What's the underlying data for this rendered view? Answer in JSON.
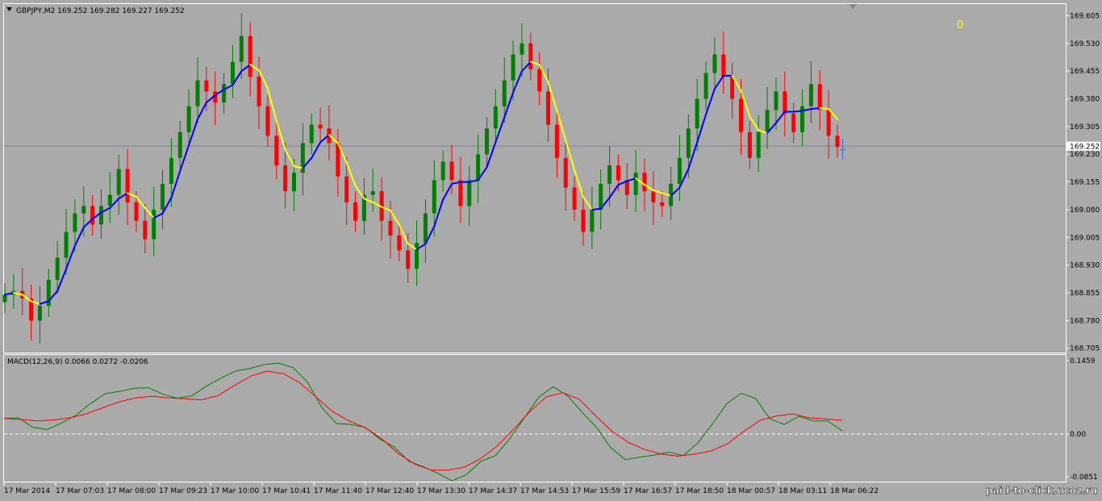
{
  "symbol_header": {
    "arrow": "▼",
    "text": "GBPJPY,M2  169.252 169.282 169.227 169.252"
  },
  "corner_counter": "0",
  "macd_header": "MACD(12,26,9) 0.0066 0.0272 -0.0206",
  "watermark": "paid-to-click.ucoz.ru",
  "colors": {
    "background": "#aaaaaa",
    "bull": "#008000",
    "bear": "#ff0000",
    "ma_rising": "#0000ff",
    "ma_falling": "#ffff00",
    "macd_main": "#008000",
    "macd_signal": "#ff0000",
    "zero_line": "#ffffff",
    "bid_line": "#7a8898",
    "counter": "#ffff00"
  },
  "chart_data": [
    {
      "type": "candlestick",
      "title": "GBPJPY,M2",
      "ylim": [
        168.7,
        169.63
      ],
      "y_ticks": [
        "169.605",
        "169.530",
        "169.455",
        "169.380",
        "169.305",
        "169.230",
        "169.155",
        "169.080",
        "169.005",
        "168.930",
        "168.855",
        "168.780",
        "168.705"
      ],
      "current_price": "169.252",
      "x_tick_labels": [
        "17 Mar 2014",
        "17 Mar 07:03",
        "17 Mar 08:00",
        "17 Mar 09:23",
        "17 Mar 10:00",
        "17 Mar 10:41",
        "17 Mar 11:40",
        "17 Mar 12:40",
        "17 Mar 13:30",
        "17 Mar 14:37",
        "17 Mar 14:53",
        "17 Mar 15:59",
        "17 Mar 16:57",
        "17 Mar 18:50",
        "18 Mar 00:57",
        "18 Mar 03:11",
        "18 Mar 06:22"
      ],
      "approx_close": [
        168.85,
        168.86,
        168.84,
        168.78,
        168.82,
        168.89,
        168.95,
        169.02,
        169.07,
        169.09,
        169.04,
        169.09,
        169.12,
        169.19,
        169.1,
        169.05,
        169.0,
        169.08,
        169.15,
        169.22,
        169.29,
        169.36,
        169.43,
        169.4,
        169.37,
        169.42,
        169.48,
        169.55,
        169.44,
        169.36,
        169.28,
        169.2,
        169.13,
        169.18,
        169.26,
        169.31,
        169.3,
        169.26,
        169.17,
        169.1,
        169.05,
        169.12,
        169.13,
        169.05,
        169.01,
        168.97,
        168.92,
        168.99,
        169.07,
        169.16,
        169.21,
        169.16,
        169.09,
        169.16,
        169.23,
        169.3,
        169.36,
        169.43,
        169.5,
        169.53,
        169.46,
        169.4,
        169.31,
        169.22,
        169.14,
        169.08,
        169.02,
        169.08,
        169.15,
        169.2,
        169.16,
        169.12,
        169.18,
        169.13,
        169.1,
        169.09,
        169.15,
        169.22,
        169.3,
        169.38,
        169.45,
        169.5,
        169.44,
        169.38,
        169.29,
        169.22,
        169.29,
        169.35,
        169.4,
        169.34,
        169.29,
        169.36,
        169.42,
        169.35,
        169.28,
        169.25
      ],
      "moving_average_color_rule": "blue while rising, yellow while falling"
    },
    {
      "type": "line",
      "title": "MACD(12,26,9)",
      "ylim": [
        -0.0851,
        0.1459
      ],
      "y_ticks": [
        "0.1459",
        "0.00",
        "-0.0851"
      ],
      "header_values": {
        "main": "0.0066",
        "signal": "0.0272",
        "histogram": "-0.0206"
      },
      "series": [
        {
          "name": "MACD",
          "values": [
            0.031,
            0.032,
            0.013,
            0.009,
            0.022,
            0.038,
            0.061,
            0.08,
            0.085,
            0.091,
            0.092,
            0.079,
            0.071,
            0.076,
            0.095,
            0.111,
            0.125,
            0.13,
            0.138,
            0.141,
            0.132,
            0.103,
            0.052,
            0.021,
            0.019,
            0.013,
            -0.01,
            -0.026,
            -0.054,
            -0.065,
            -0.078,
            -0.093,
            -0.081,
            -0.054,
            -0.043,
            -0.009,
            0.032,
            0.073,
            0.094,
            0.076,
            0.043,
            0.013,
            -0.028,
            -0.051,
            -0.046,
            -0.042,
            -0.036,
            -0.043,
            -0.018,
            0.019,
            0.06,
            0.081,
            0.071,
            0.03,
            0.019,
            0.035,
            0.026,
            0.026,
            0.006
          ]
        },
        {
          "name": "Signal",
          "values": [
            0.031,
            0.029,
            0.026,
            0.028,
            0.032,
            0.04,
            0.052,
            0.064,
            0.072,
            0.075,
            0.072,
            0.07,
            0.068,
            0.076,
            0.096,
            0.115,
            0.125,
            0.12,
            0.102,
            0.073,
            0.044,
            0.026,
            0.012,
            -0.01,
            -0.039,
            -0.06,
            -0.072,
            -0.072,
            -0.066,
            -0.049,
            -0.024,
            0.009,
            0.045,
            0.074,
            0.082,
            0.069,
            0.036,
            0.005,
            -0.017,
            -0.031,
            -0.04,
            -0.044,
            -0.04,
            -0.034,
            -0.02,
            0.005,
            0.027,
            0.036,
            0.04,
            0.032,
            0.03,
            0.027
          ]
        }
      ]
    }
  ]
}
